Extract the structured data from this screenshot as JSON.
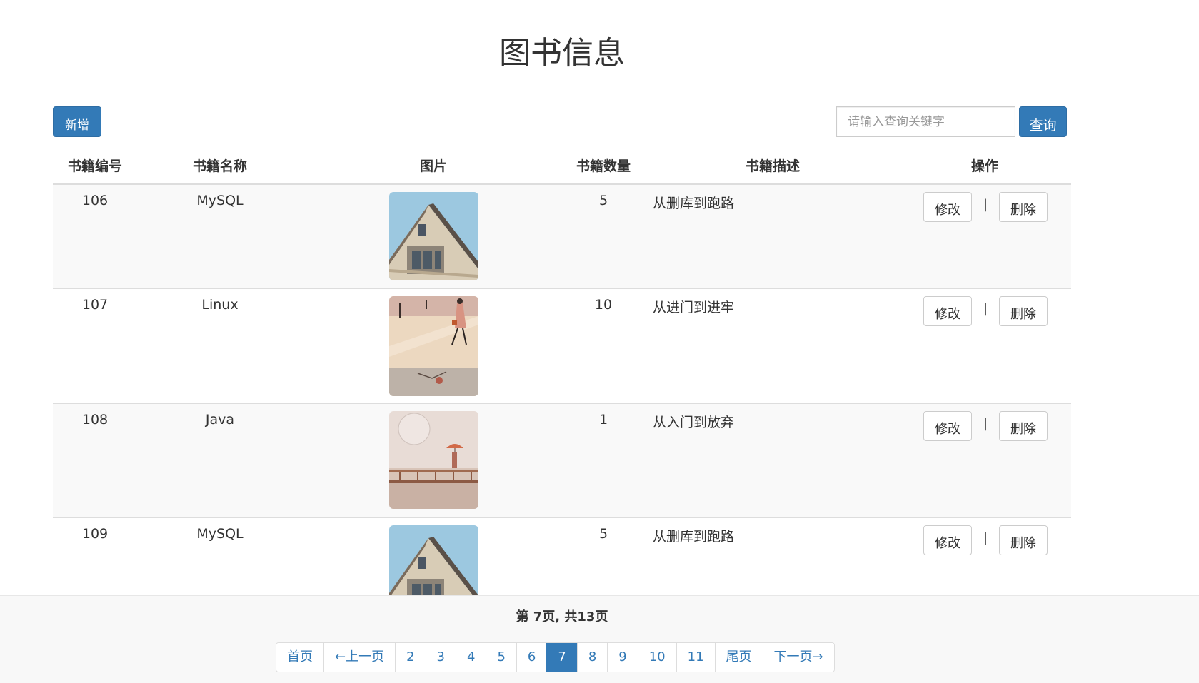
{
  "header": {
    "title": "图书信息"
  },
  "toolbar": {
    "add_label": "新增",
    "search_placeholder": "请输入查询关键字",
    "search_value": "",
    "search_label": "查询"
  },
  "table": {
    "columns": [
      "书籍编号",
      "书籍名称",
      "图片",
      "书籍数量",
      "书籍描述",
      "操作"
    ],
    "rows": [
      {
        "id": "106",
        "name": "MySQL",
        "image": "house-illustration",
        "count": "5",
        "desc": "从删库到跑路"
      },
      {
        "id": "107",
        "name": "Linux",
        "image": "walking-woman-illustration",
        "count": "10",
        "desc": "从进门到进牢"
      },
      {
        "id": "108",
        "name": "Java",
        "image": "bridge-umbrella-illustration",
        "count": "1",
        "desc": "从入门到放弃"
      },
      {
        "id": "109",
        "name": "MySQL",
        "image": "house-illustration",
        "count": "5",
        "desc": "从删库到跑路"
      }
    ],
    "edit_label": "修改",
    "separator": "|",
    "delete_label": "删除"
  },
  "pagination": {
    "info": "第 7页, 共13页",
    "first": "首页",
    "prev": "←上一页",
    "pages": [
      "2",
      "3",
      "4",
      "5",
      "6",
      "7",
      "8",
      "9",
      "10",
      "11"
    ],
    "current": "7",
    "last": "尾页",
    "next": "下一页→"
  },
  "colors": {
    "primary": "#337ab7",
    "stripe": "#f9f9f9",
    "footer_bg": "#f8f8f8"
  }
}
